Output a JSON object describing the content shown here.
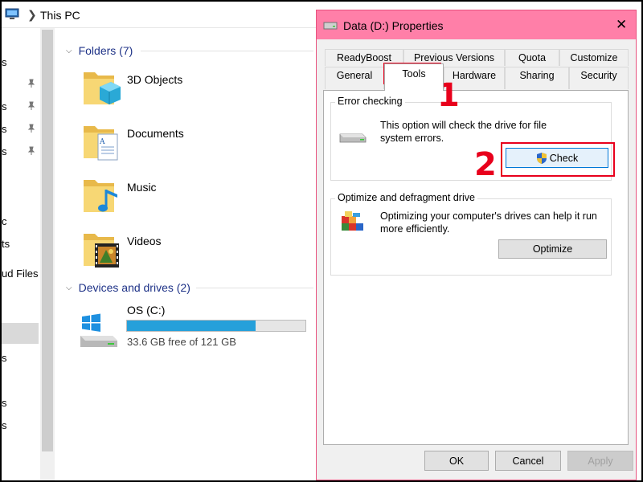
{
  "explorer": {
    "title": "This PC",
    "nav_items": [
      "s",
      "s",
      "s",
      "s",
      "c",
      "ts",
      "ud Files",
      "s",
      "s",
      "s"
    ],
    "groups": {
      "folders_label": "Folders (7)",
      "devices_label": "Devices and drives (2)"
    },
    "folders": [
      {
        "name": "3D Objects",
        "icon": "3d-objects-folder-icon"
      },
      {
        "name": "Documents",
        "icon": "documents-folder-icon"
      },
      {
        "name": "Music",
        "icon": "music-folder-icon"
      },
      {
        "name": "Videos",
        "icon": "videos-folder-icon"
      }
    ],
    "drive": {
      "name": "OS (C:)",
      "free_text": "33.6 GB free of 121 GB",
      "used_fraction": 0.72
    }
  },
  "dialog": {
    "title": "Data (D:) Properties",
    "close_glyph": "✕",
    "tabs_row1": [
      "ReadyBoost",
      "Previous Versions",
      "Quota",
      "Customize"
    ],
    "tabs_row2": [
      "General",
      "Tools",
      "Hardware",
      "Sharing",
      "Security"
    ],
    "active_tab": "Tools",
    "error_checking": {
      "title": "Error checking",
      "text": "This option will check the drive for file system errors.",
      "button": "Check"
    },
    "optimize": {
      "title": "Optimize and defragment drive",
      "text": "Optimizing your computer's drives can help it run more efficiently.",
      "button": "Optimize"
    },
    "buttons": {
      "ok": "OK",
      "cancel": "Cancel",
      "apply": "Apply"
    }
  },
  "annotations": {
    "step1": "1",
    "step2": "2"
  },
  "colors": {
    "titlebar": "#ff7fa8",
    "annotation": "#e8001c",
    "drive_bar": "#26a0da",
    "group_header": "#1e3287"
  }
}
